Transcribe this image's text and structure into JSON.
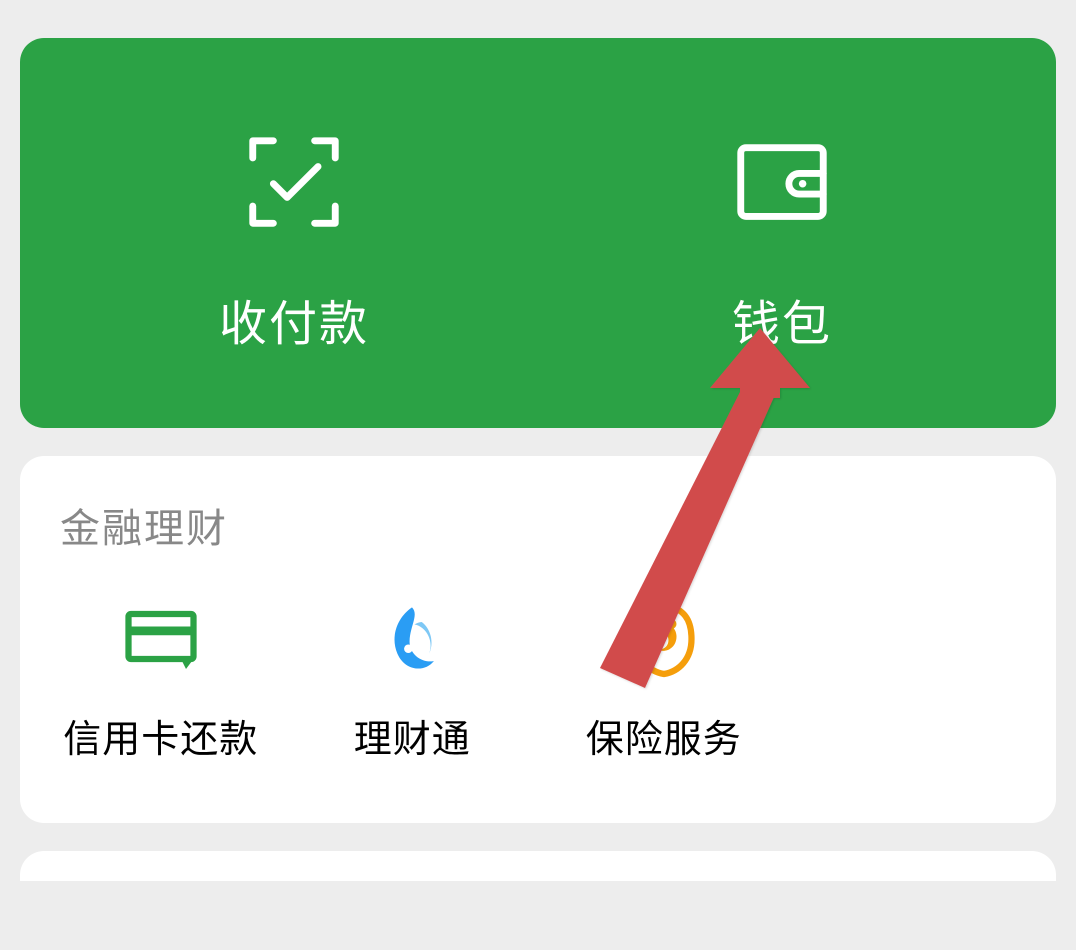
{
  "header": {
    "pay_receive": {
      "label": "收付款",
      "icon": "scan-check-icon"
    },
    "wallet": {
      "label": "钱包",
      "icon": "wallet-icon"
    }
  },
  "finance_section": {
    "title": "金融理财",
    "items": [
      {
        "label": "信用卡还款",
        "icon": "credit-card-repay-icon"
      },
      {
        "label": "理财通",
        "icon": "licai-tong-icon"
      },
      {
        "label": "保险服务",
        "icon": "insurance-icon"
      }
    ]
  },
  "colors": {
    "brand_green": "#2ba245",
    "icon_green": "#2ba245",
    "icon_blue": "#2a9df4",
    "icon_orange": "#f59e0b",
    "arrow_red": "#d14c4c"
  },
  "annotation": {
    "arrow_target": "wallet"
  }
}
